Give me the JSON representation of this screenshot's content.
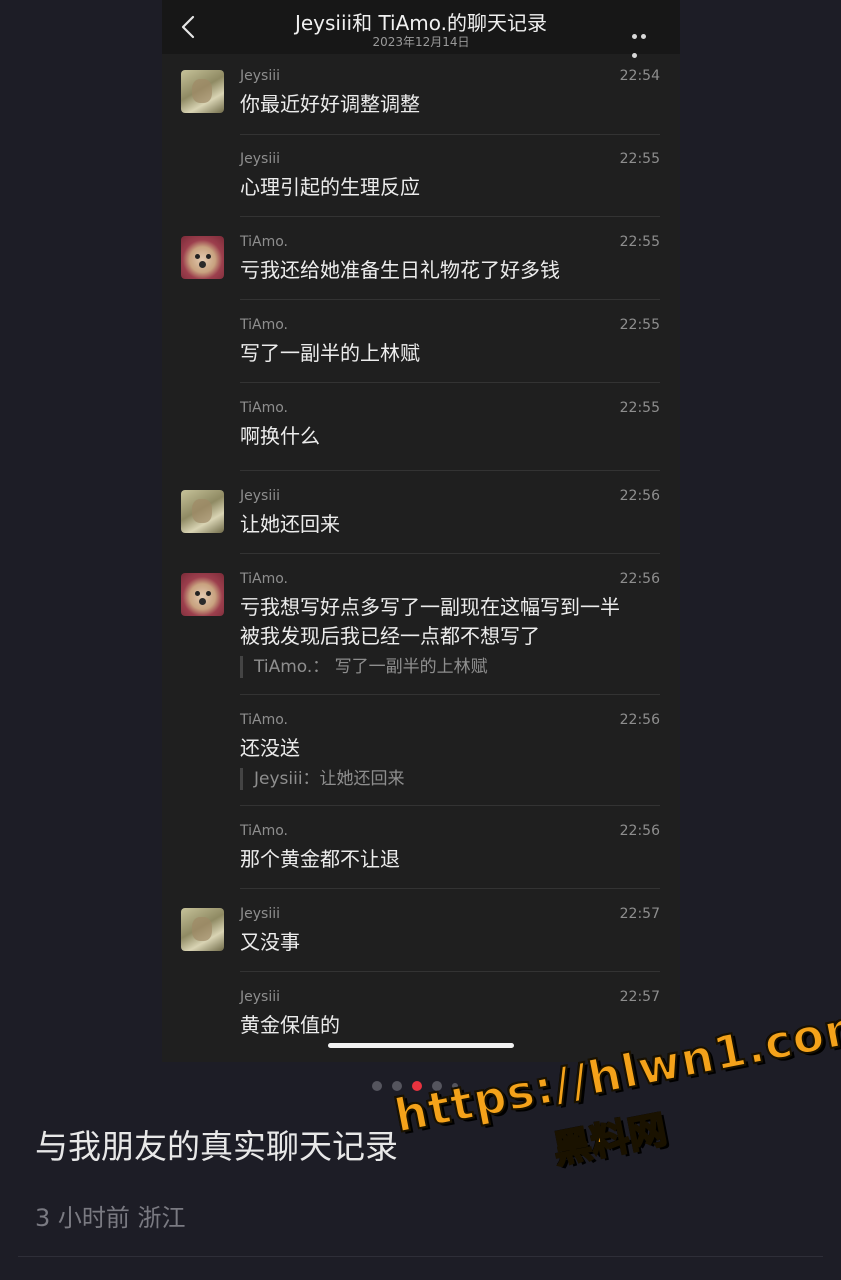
{
  "topbar": {
    "title": "Jeysiii和 TiAmo.的聊天记录",
    "date": "2023年12月14日"
  },
  "icons": {
    "back": "chevron-left-icon",
    "more": "ellipsis-icon"
  },
  "messages": [
    {
      "sender": "Jeysiii",
      "time": "22:54",
      "text": "你最近好好调整调整",
      "avatar": "jey"
    },
    {
      "sender": "Jeysiii",
      "time": "22:55",
      "text": "心理引起的生理反应",
      "avatar": ""
    },
    {
      "sender": "TiAmo.",
      "time": "22:55",
      "text": "亏我还给她准备生日礼物花了好多钱",
      "avatar": "tia"
    },
    {
      "sender": "TiAmo.",
      "time": "22:55",
      "text": "写了一副半的上林赋",
      "avatar": ""
    },
    {
      "sender": "TiAmo.",
      "time": "22:55",
      "text": "啊换什么",
      "avatar": ""
    },
    {
      "sender": "Jeysiii",
      "time": "22:56",
      "text": "让她还回来",
      "avatar": "jey"
    },
    {
      "sender": "TiAmo.",
      "time": "22:56",
      "text_line1": "亏我想写好点多写了一副现在这幅写到一半",
      "text_line2": "被我发现后我已经一点都不想写了",
      "quote": "TiAmo.：  写了一副半的上林赋",
      "avatar": "tia"
    },
    {
      "sender": "TiAmo.",
      "time": "22:56",
      "text": "还没送",
      "quote": "Jeysiii：让她还回来",
      "avatar": ""
    },
    {
      "sender": "TiAmo.",
      "time": "22:56",
      "text": "那个黄金都不让退",
      "avatar": ""
    },
    {
      "sender": "Jeysiii",
      "time": "22:57",
      "text": "又没事",
      "avatar": "jey"
    },
    {
      "sender": "Jeysiii",
      "time": "22:57",
      "text": "黄金保值的",
      "avatar": ""
    }
  ],
  "pager": {
    "count": 5,
    "active_index": 2,
    "active_color": "#e8333f"
  },
  "post": {
    "title": "与我朋友的真实聊天记录",
    "meta": "3 小时前  浙江"
  },
  "watermark": {
    "url": "https://hlwn1.com",
    "name": "黑料网",
    "color": "#f4a21a"
  }
}
